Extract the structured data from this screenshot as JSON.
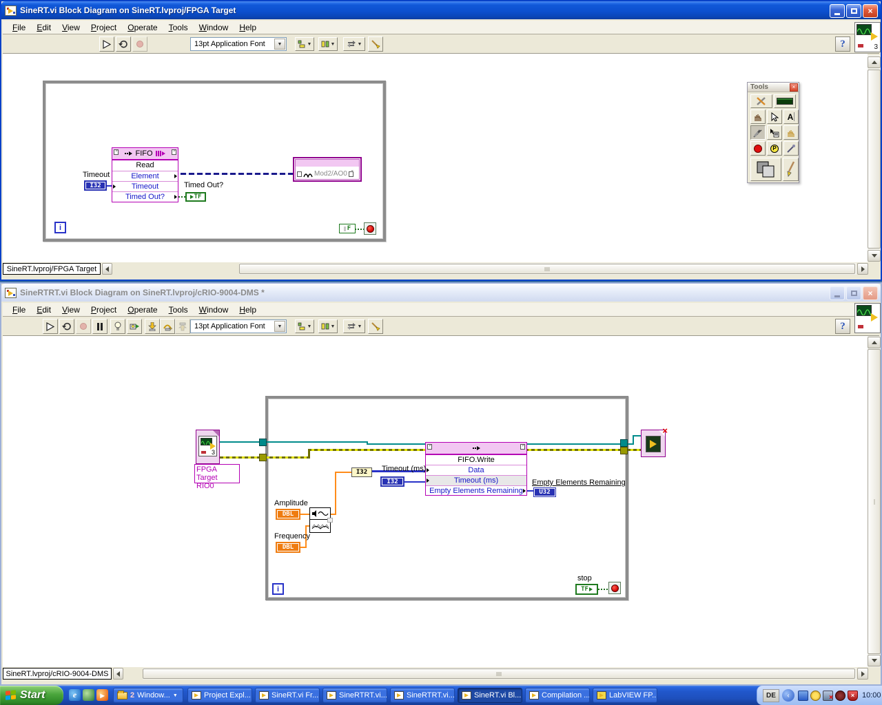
{
  "menu": [
    "File",
    "Edit",
    "View",
    "Project",
    "Operate",
    "Tools",
    "Window",
    "Help"
  ],
  "toolbar": {
    "font_selector": "13pt Application Font",
    "help_label": "?"
  },
  "fpga_window": {
    "title": "SineRT.vi Block Diagram on SineRT.lvproj/FPGA Target",
    "context_tab": "SineRT.lvproj/FPGA Target",
    "vi_icon_badge": "3",
    "diagram": {
      "fifo_header": "FIFO",
      "row_read": "Read",
      "row_element": "Element",
      "row_timeout": "Timeout",
      "row_timed_out": "Timed Out?",
      "timeout_label": "Timeout",
      "timeout_type": "I32",
      "timed_out_label": "Timed Out?",
      "timed_out_type": "TF",
      "io_node": "Mod2/AO0",
      "iteration": "i",
      "false_const": "F"
    }
  },
  "tools_palette": {
    "title": "Tools"
  },
  "rt_window": {
    "title": "SineRTRT.vi Block Diagram on SineRT.lvproj/cRIO-9004-DMS *",
    "context_tab": "SineRT.lvproj/cRIO-9004-DMS",
    "diagram": {
      "fpga_target_line1": "FPGA Target",
      "fpga_target_line2": "RIO0",
      "fpga_icon_badge": "3",
      "invoke_title": "FIFO.Write",
      "row_data": "Data",
      "row_timeout": "Timeout (ms)",
      "row_empty": "Empty Elements Remaining",
      "conv_type": "I32",
      "timeout_label": "Timeout (ms)",
      "timeout_type": "I32",
      "empty_label": "Empty Elements Remaining",
      "empty_type": "U32",
      "amplitude_label": "Amplitude",
      "frequency_label": "Frequency",
      "dbl_type": "DBL",
      "stop_label": "stop",
      "stop_type": "TF",
      "iteration": "i"
    }
  },
  "taskbar": {
    "start_label": "Start",
    "group_count": "2",
    "group_label": "Window...",
    "buttons": [
      "Project Expl...",
      "SineRT.vi Fr...",
      "SineRTRT.vi...",
      "SineRTRT.vi...",
      "SineRT.vi Bl...",
      "Compilation ...",
      "LabVIEW FP..."
    ],
    "tray_lang": "DE",
    "clock": "10:00"
  }
}
